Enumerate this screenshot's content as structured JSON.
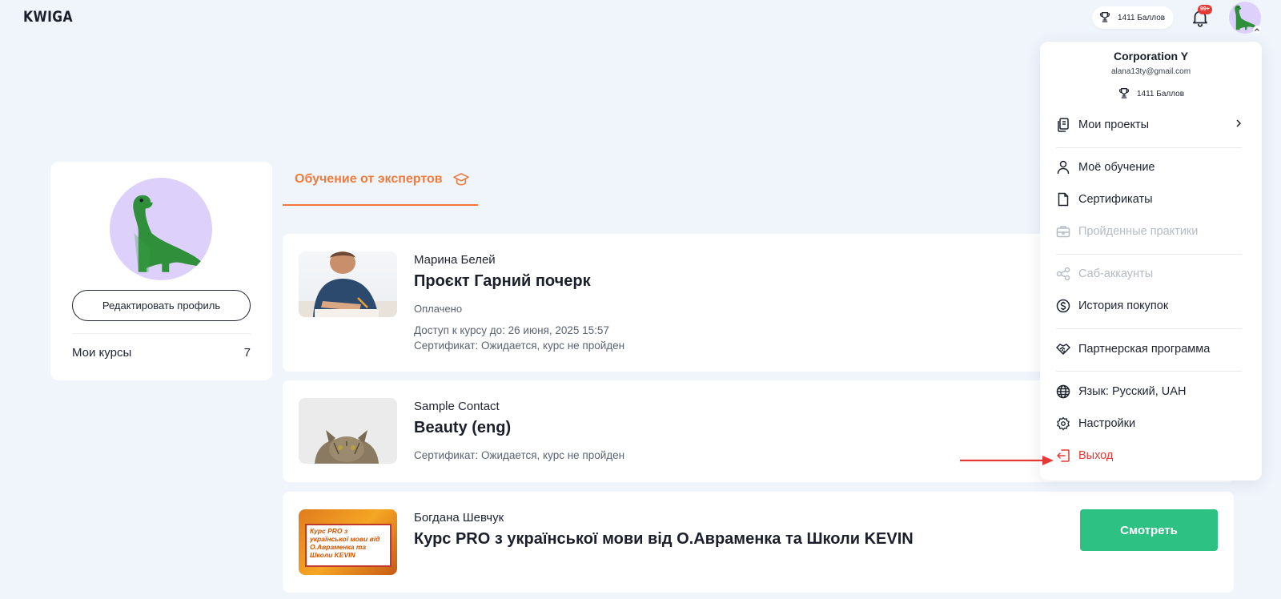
{
  "header": {
    "logo": "KWIGA",
    "points_label": "1411 Баллов",
    "notifications_badge": "99+"
  },
  "profile": {
    "edit_button": "Редактировать профиль",
    "my_courses_label": "Мои курсы",
    "my_courses_count": "7"
  },
  "tab": {
    "label": "Обучение от экспертов"
  },
  "courses": [
    {
      "author": "Марина Белей",
      "title": "Проєкт Гарний почерк",
      "status": "Оплачено",
      "access": "Доступ к курсу до: 26 июня, 2025 15:57",
      "certificate": "Сертификат:  Ожидается, курс не пройден"
    },
    {
      "author": "Sample Contact",
      "title": "Beauty (eng)",
      "certificate": "Сертификат:  Ожидается, курс не пройден"
    },
    {
      "author": "Богдана Шевчук",
      "title": "Курс PRO з української мови від О.Авраменка та Школи KEVIN",
      "watch_button": "Смотреть",
      "thumb_text": "Курс PRO з української мови від О.Авраменка та Школи KEVIN"
    }
  ],
  "dropdown": {
    "name": "Corporation Y",
    "email": "alana13ty@gmail.com",
    "points": "1411 Баллов",
    "items": [
      {
        "label": "Мои проекты",
        "icon": "projects-icon"
      },
      {
        "label": "Моё обучение",
        "icon": "user-icon"
      },
      {
        "label": "Сертификаты",
        "icon": "document-icon"
      },
      {
        "label": "Пройденные практики",
        "icon": "briefcase-icon",
        "disabled": true
      },
      {
        "label": "Саб-аккаунты",
        "icon": "share-icon",
        "disabled": true
      },
      {
        "label": "История покупок",
        "icon": "dollar-icon"
      },
      {
        "label": "Партнерская программа",
        "icon": "handshake-icon"
      },
      {
        "label": "Язык: Русский, UAH",
        "icon": "globe-icon"
      },
      {
        "label": "Настройки",
        "icon": "gear-icon"
      },
      {
        "label": "Выход",
        "icon": "logout-icon"
      }
    ]
  },
  "colors": {
    "accent": "#f07a3c",
    "success": "#2dc184",
    "danger": "#e53935",
    "background": "#f0f5fc",
    "avatar_bg": "#ddd0fb"
  }
}
